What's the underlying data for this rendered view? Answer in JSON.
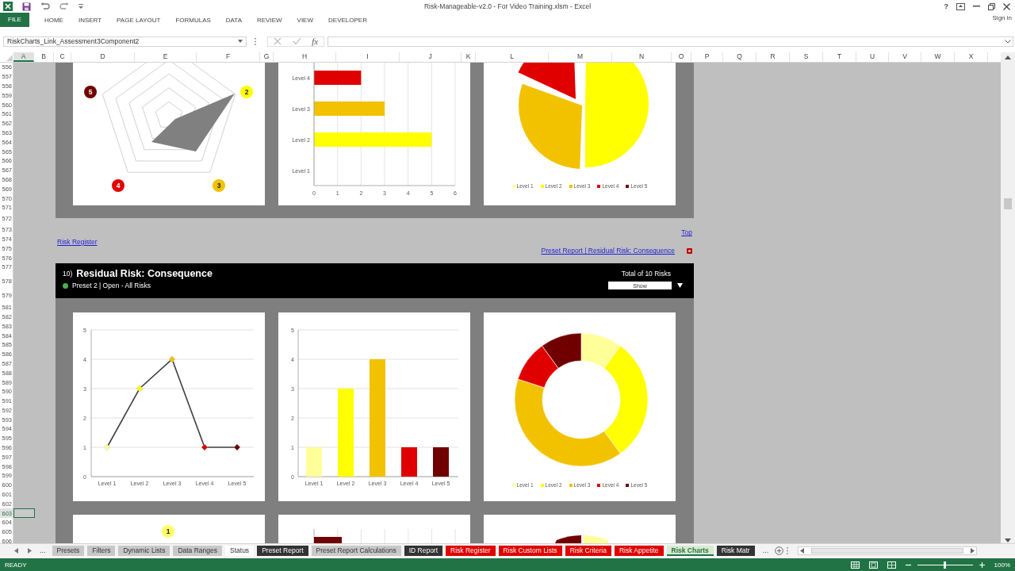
{
  "title_bar": {
    "title": "Risk-Manageable-v2.0 - For Video Training.xlsm - Excel",
    "help": "?"
  },
  "ribbon": {
    "file": "FILE",
    "tabs": [
      "HOME",
      "INSERT",
      "PAGE LAYOUT",
      "FORMULAS",
      "DATA",
      "REVIEW",
      "VIEW",
      "DEVELOPER"
    ],
    "sign_in": "Sign in"
  },
  "formula_bar": {
    "name_box": "RiskCharts_Link_Assessment3Component2",
    "fx": "fx"
  },
  "columns": [
    {
      "label": "A",
      "selected": true
    },
    {
      "label": "B",
      "selected": false
    },
    {
      "label": "C",
      "selected": false
    },
    {
      "label": "D",
      "selected": false
    },
    {
      "label": "E",
      "selected": false
    },
    {
      "label": "F",
      "selected": false
    },
    {
      "label": "G",
      "selected": false
    },
    {
      "label": "H",
      "selected": false
    },
    {
      "label": "I",
      "selected": false
    },
    {
      "label": "J",
      "selected": false
    },
    {
      "label": "K",
      "selected": false
    },
    {
      "label": "L",
      "selected": false
    },
    {
      "label": "M",
      "selected": false
    },
    {
      "label": "N",
      "selected": false
    },
    {
      "label": "O",
      "selected": false
    },
    {
      "label": "P",
      "selected": false
    },
    {
      "label": "Q",
      "selected": false
    },
    {
      "label": "R",
      "selected": false
    },
    {
      "label": "S",
      "selected": false
    },
    {
      "label": "T",
      "selected": false
    },
    {
      "label": "U",
      "selected": false
    },
    {
      "label": "V",
      "selected": false
    },
    {
      "label": "W",
      "selected": false
    },
    {
      "label": "X",
      "selected": false
    }
  ],
  "rows": [
    {
      "label": "556",
      "selected": false
    },
    {
      "label": "557",
      "selected": false
    },
    {
      "label": "558",
      "selected": false
    },
    {
      "label": "559",
      "selected": false
    },
    {
      "label": "560",
      "selected": false
    },
    {
      "label": "561",
      "selected": false
    },
    {
      "label": "562",
      "selected": false
    },
    {
      "label": "563",
      "selected": false
    },
    {
      "label": "564",
      "selected": false
    },
    {
      "label": "565",
      "selected": false
    },
    {
      "label": "566",
      "selected": false
    },
    {
      "label": "567",
      "selected": false
    },
    {
      "label": "568",
      "selected": false
    },
    {
      "label": "569",
      "selected": false
    },
    {
      "label": "570",
      "selected": false
    },
    {
      "label": "571",
      "selected": false
    },
    {
      "label": "572",
      "selected": false
    },
    {
      "label": "573",
      "selected": false
    },
    {
      "label": "574",
      "selected": false
    },
    {
      "label": "575",
      "selected": false
    },
    {
      "label": "576",
      "selected": false
    },
    {
      "label": "577",
      "selected": false
    },
    {
      "label": "578",
      "selected": false
    },
    {
      "label": "579",
      "selected": false
    },
    {
      "label": "581",
      "selected": false
    },
    {
      "label": "582",
      "selected": false
    },
    {
      "label": "583",
      "selected": false
    },
    {
      "label": "584",
      "selected": false
    },
    {
      "label": "585",
      "selected": false
    },
    {
      "label": "586",
      "selected": false
    },
    {
      "label": "587",
      "selected": false
    },
    {
      "label": "588",
      "selected": false
    },
    {
      "label": "589",
      "selected": false
    },
    {
      "label": "590",
      "selected": false
    },
    {
      "label": "591",
      "selected": false
    },
    {
      "label": "592",
      "selected": false
    },
    {
      "label": "593",
      "selected": false
    },
    {
      "label": "594",
      "selected": false
    },
    {
      "label": "595",
      "selected": false
    },
    {
      "label": "596",
      "selected": false
    },
    {
      "label": "597",
      "selected": false
    },
    {
      "label": "598",
      "selected": false
    },
    {
      "label": "599",
      "selected": false
    },
    {
      "label": "600",
      "selected": false
    },
    {
      "label": "601",
      "selected": false
    },
    {
      "label": "602",
      "selected": false
    },
    {
      "label": "603",
      "selected": true
    },
    {
      "label": "604",
      "selected": false
    },
    {
      "label": "605",
      "selected": false
    },
    {
      "label": "606",
      "selected": false
    }
  ],
  "top_section": {
    "radar_badges": [
      {
        "label": "5",
        "color": "#700000"
      },
      {
        "label": "2",
        "color": "#ffff00"
      },
      {
        "label": "4",
        "color": "#e00000"
      },
      {
        "label": "3",
        "color": "#f2c200"
      }
    ],
    "bar_chart": {
      "chart_data": {
        "type": "bar",
        "orientation": "horizontal",
        "categories": [
          "Level 4",
          "Level 3",
          "Level 2",
          "Level 1"
        ],
        "values": [
          2,
          3,
          5,
          0
        ],
        "xlim": [
          0,
          6
        ],
        "xticks": [
          0,
          1,
          2,
          3,
          4,
          5,
          6
        ],
        "grid": true
      }
    },
    "pie_legend": [
      {
        "label": "Level 1",
        "color": "#ffff99"
      },
      {
        "label": "Level 2",
        "color": "#ffff00"
      },
      {
        "label": "Level 3",
        "color": "#f2c200"
      },
      {
        "label": "Level 4",
        "color": "#e00000"
      },
      {
        "label": "Level 5",
        "color": "#700000"
      }
    ]
  },
  "links": {
    "top": "Top",
    "risk_register": "Risk Register",
    "preset_report": "Preset Report | Residual Risk: Consequence"
  },
  "section": {
    "number": "10)",
    "title": "Residual Risk: Consequence",
    "preset": "Preset 2 | Open - All Risks",
    "total": "Total of 10 Risks",
    "show": "Show"
  },
  "line_chart": {
    "chart_data": {
      "type": "line",
      "categories": [
        "Level 1",
        "Level 2",
        "Level 3",
        "Level 4",
        "Level 5"
      ],
      "values": [
        1,
        3,
        4,
        1,
        1
      ],
      "ylim": [
        0,
        5
      ],
      "yticks": [
        0,
        1,
        2,
        3,
        4,
        5
      ],
      "grid": true,
      "marker": true
    }
  },
  "column_chart": {
    "chart_data": {
      "type": "bar",
      "categories": [
        "Level 1",
        "Level 2",
        "Level 3",
        "Level 4",
        "Level 5"
      ],
      "values": [
        1,
        3,
        4,
        1,
        1
      ],
      "ylim": [
        0,
        5
      ],
      "yticks": [
        0,
        1,
        2,
        3,
        4,
        5
      ],
      "grid": true
    }
  },
  "donut_legend": [
    {
      "label": "Level 1",
      "color": "#ffff99"
    },
    {
      "label": "Level 2",
      "color": "#ffff00"
    },
    {
      "label": "Level 3",
      "color": "#f2c200"
    },
    {
      "label": "Level 4",
      "color": "#e00000"
    },
    {
      "label": "Level 5",
      "color": "#700000"
    }
  ],
  "next_section": {
    "badge": {
      "label": "1",
      "color": "#ffff66"
    }
  },
  "sheet_tabs": {
    "more_left": "...",
    "more_right": "...",
    "tabs": [
      {
        "label": "Presets",
        "color": "#c8c8c8",
        "selected": false
      },
      {
        "label": "Filters",
        "color": "#c8c8c8",
        "selected": false
      },
      {
        "label": "Dynamic Lists",
        "color": "#c8c8c8",
        "selected": false
      },
      {
        "label": "Data Ranges",
        "color": "#c8c8c8",
        "selected": false
      },
      {
        "label": "Status",
        "color": "#ffffff",
        "selected": false
      },
      {
        "label": "Preset Report",
        "color": "#333333",
        "selected": false
      },
      {
        "label": "Preset Report Calculations",
        "color": "#c8c8c8",
        "selected": false
      },
      {
        "label": "ID Report",
        "color": "#333333",
        "selected": false
      },
      {
        "label": "Risk Register",
        "color": "#e00000",
        "selected": false
      },
      {
        "label": "Risk Custom Lists",
        "color": "#e00000",
        "selected": false
      },
      {
        "label": "Risk Criteria",
        "color": "#e00000",
        "selected": false
      },
      {
        "label": "Risk Appetite",
        "color": "#e00000",
        "selected": false
      },
      {
        "label": "Risk Charts",
        "color": "#d9ead0",
        "selected": true
      },
      {
        "label": "Risk Matr",
        "color": "#333333",
        "selected": false
      }
    ]
  },
  "status_bar": {
    "status": "READY",
    "zoom_slider": {
      "level": 0.5
    },
    "zoom": "100%"
  }
}
